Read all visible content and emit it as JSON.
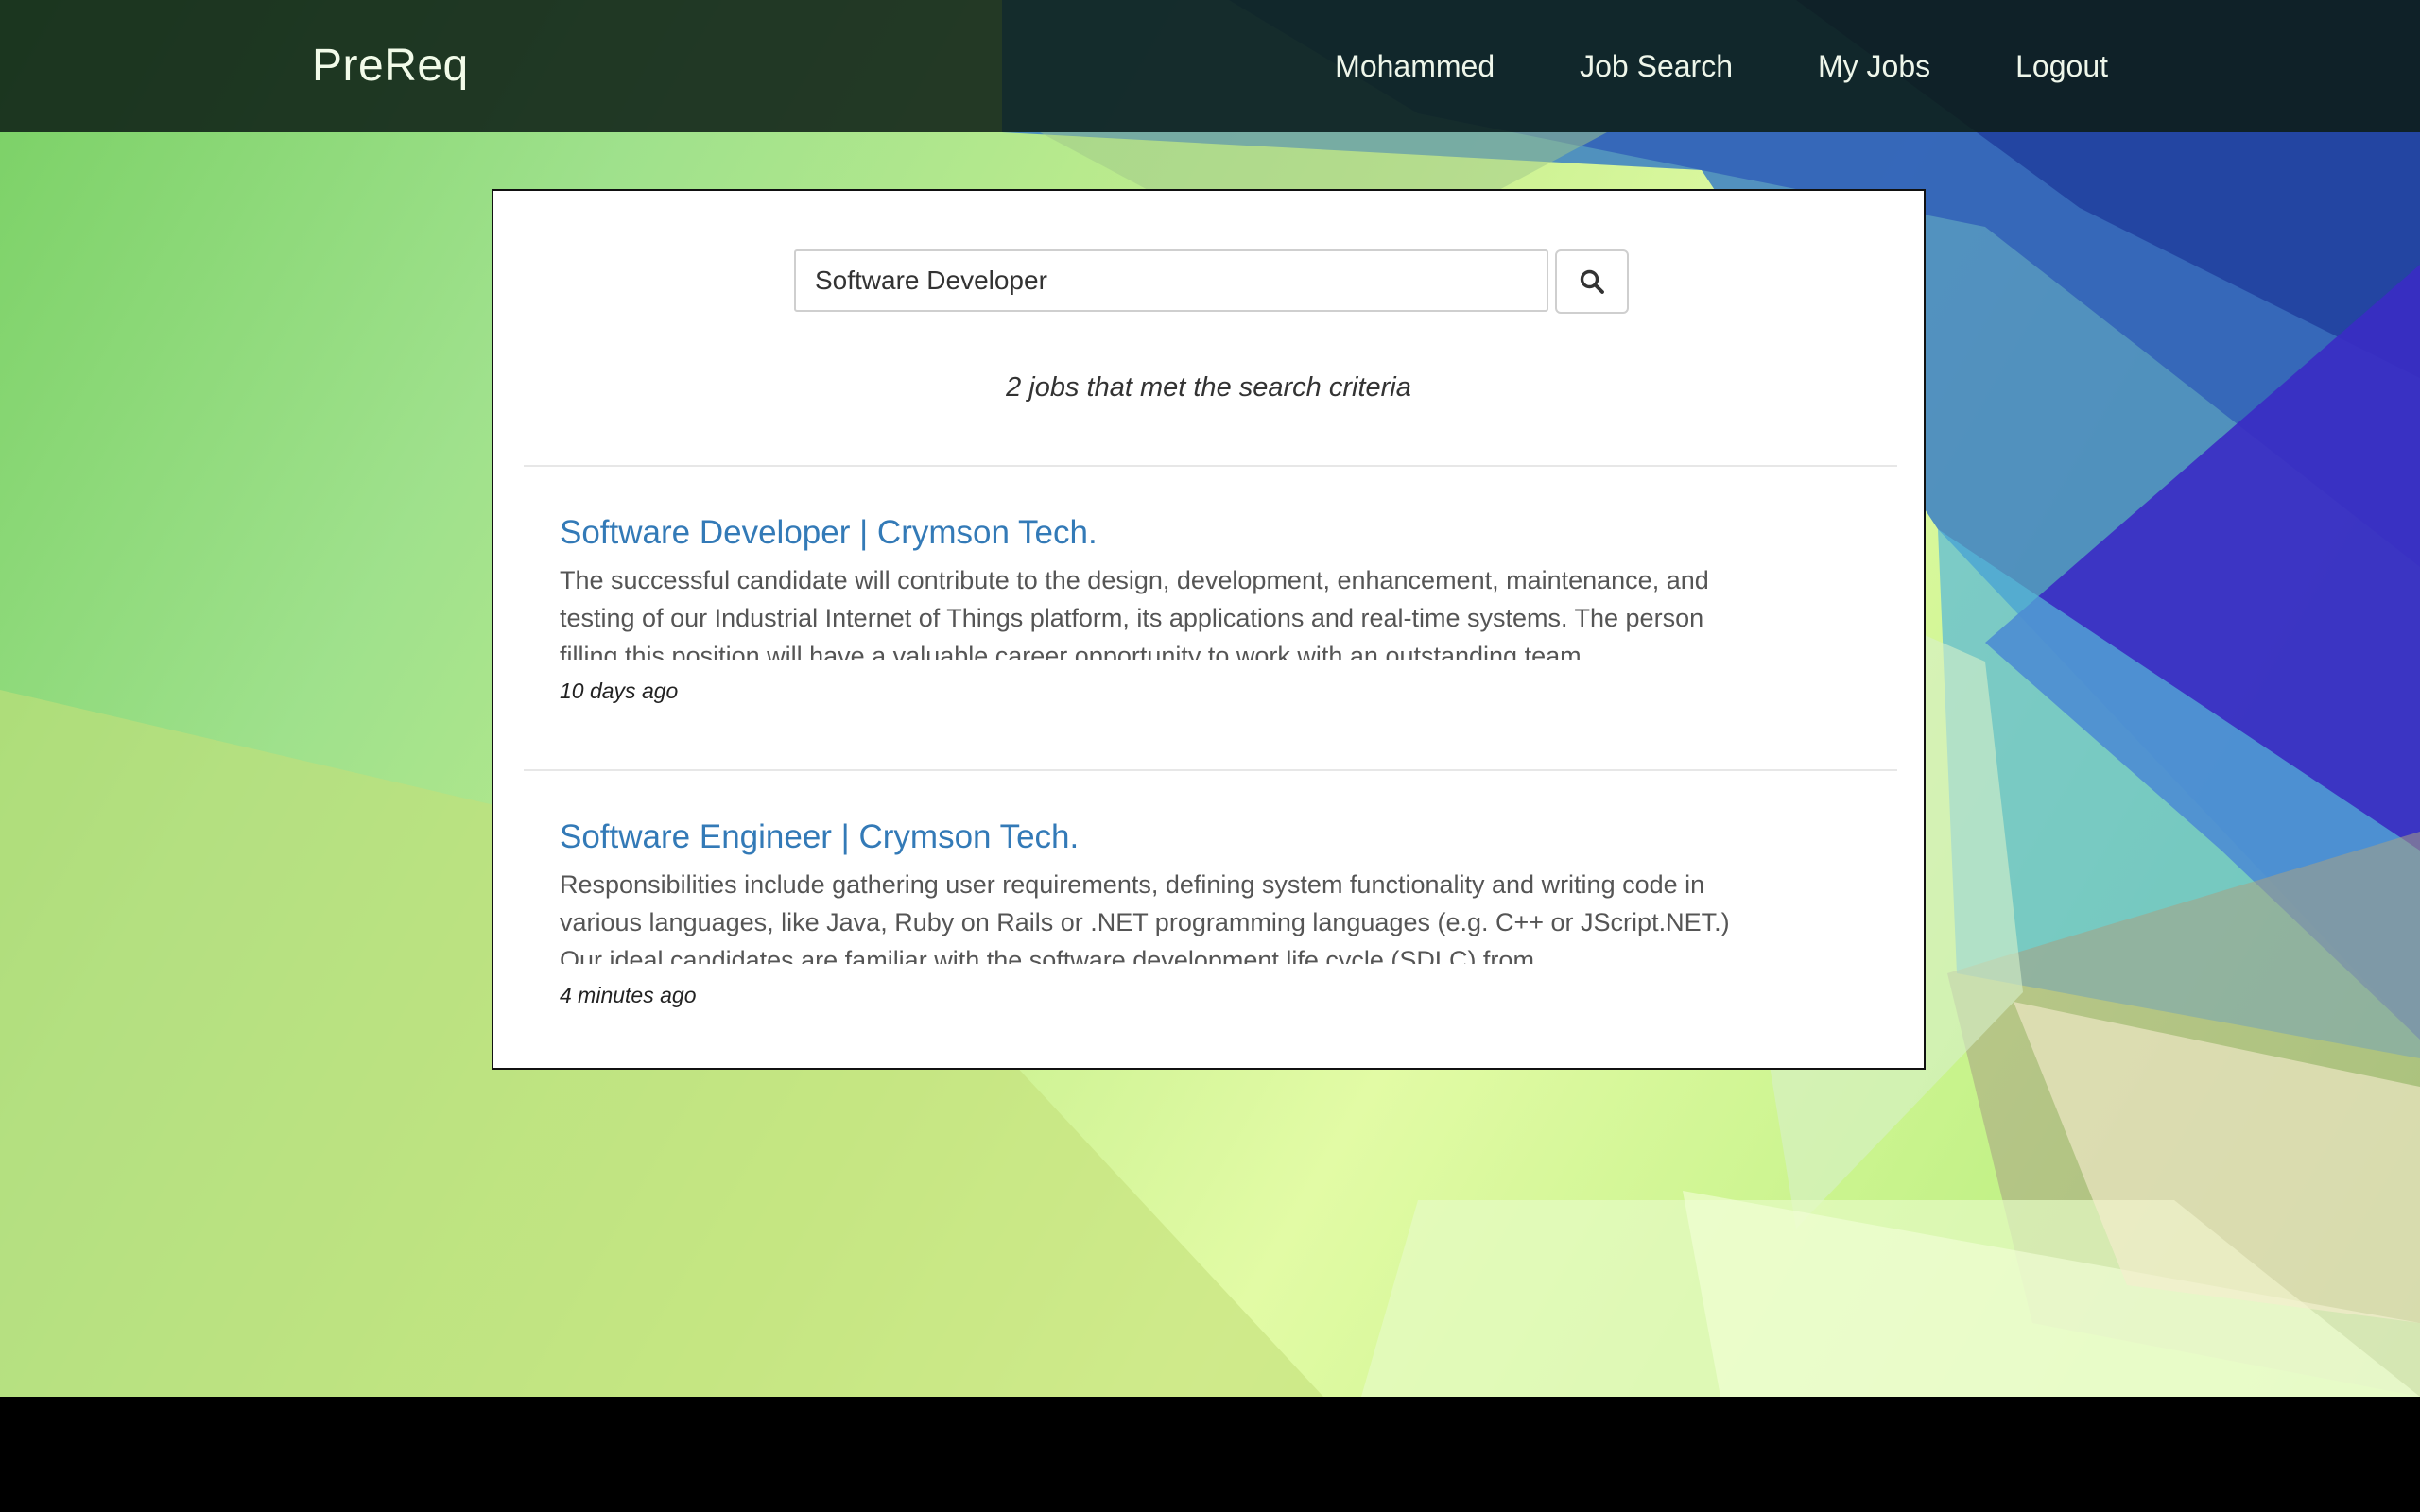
{
  "header": {
    "brand": "PreReq",
    "nav": [
      {
        "label": "Mohammed"
      },
      {
        "label": "Job Search"
      },
      {
        "label": "My Jobs"
      },
      {
        "label": "Logout"
      }
    ]
  },
  "search": {
    "value": "Software Developer",
    "button_icon": "search-icon",
    "result_count_text": "2 jobs that met the search criteria"
  },
  "jobs": [
    {
      "title": "Software Developer  |  Crymson Tech.",
      "description": "The successful candidate will contribute to the design, development, enhancement, maintenance, and testing of our Industrial Internet of Things platform, its applications and real-time systems. The person filling this position will have a valuable career opportunity to work with an outstanding team",
      "posted": "10 days ago"
    },
    {
      "title": "Software Engineer  |  Crymson Tech.",
      "description": "Responsibilities include gathering user requirements, defining system functionality and writing code in various languages, like Java, Ruby on Rails or .NET programming languages (e.g. C++ or JScript.NET.) Our ideal candidates are familiar with the software development life cycle (SDLC) from",
      "posted": "4 minutes ago"
    }
  ],
  "colors": {
    "link": "#337ab7",
    "navbar": "#0c1c14",
    "background_green": "#9fe18c",
    "background_blue": "#2f6fc0"
  }
}
